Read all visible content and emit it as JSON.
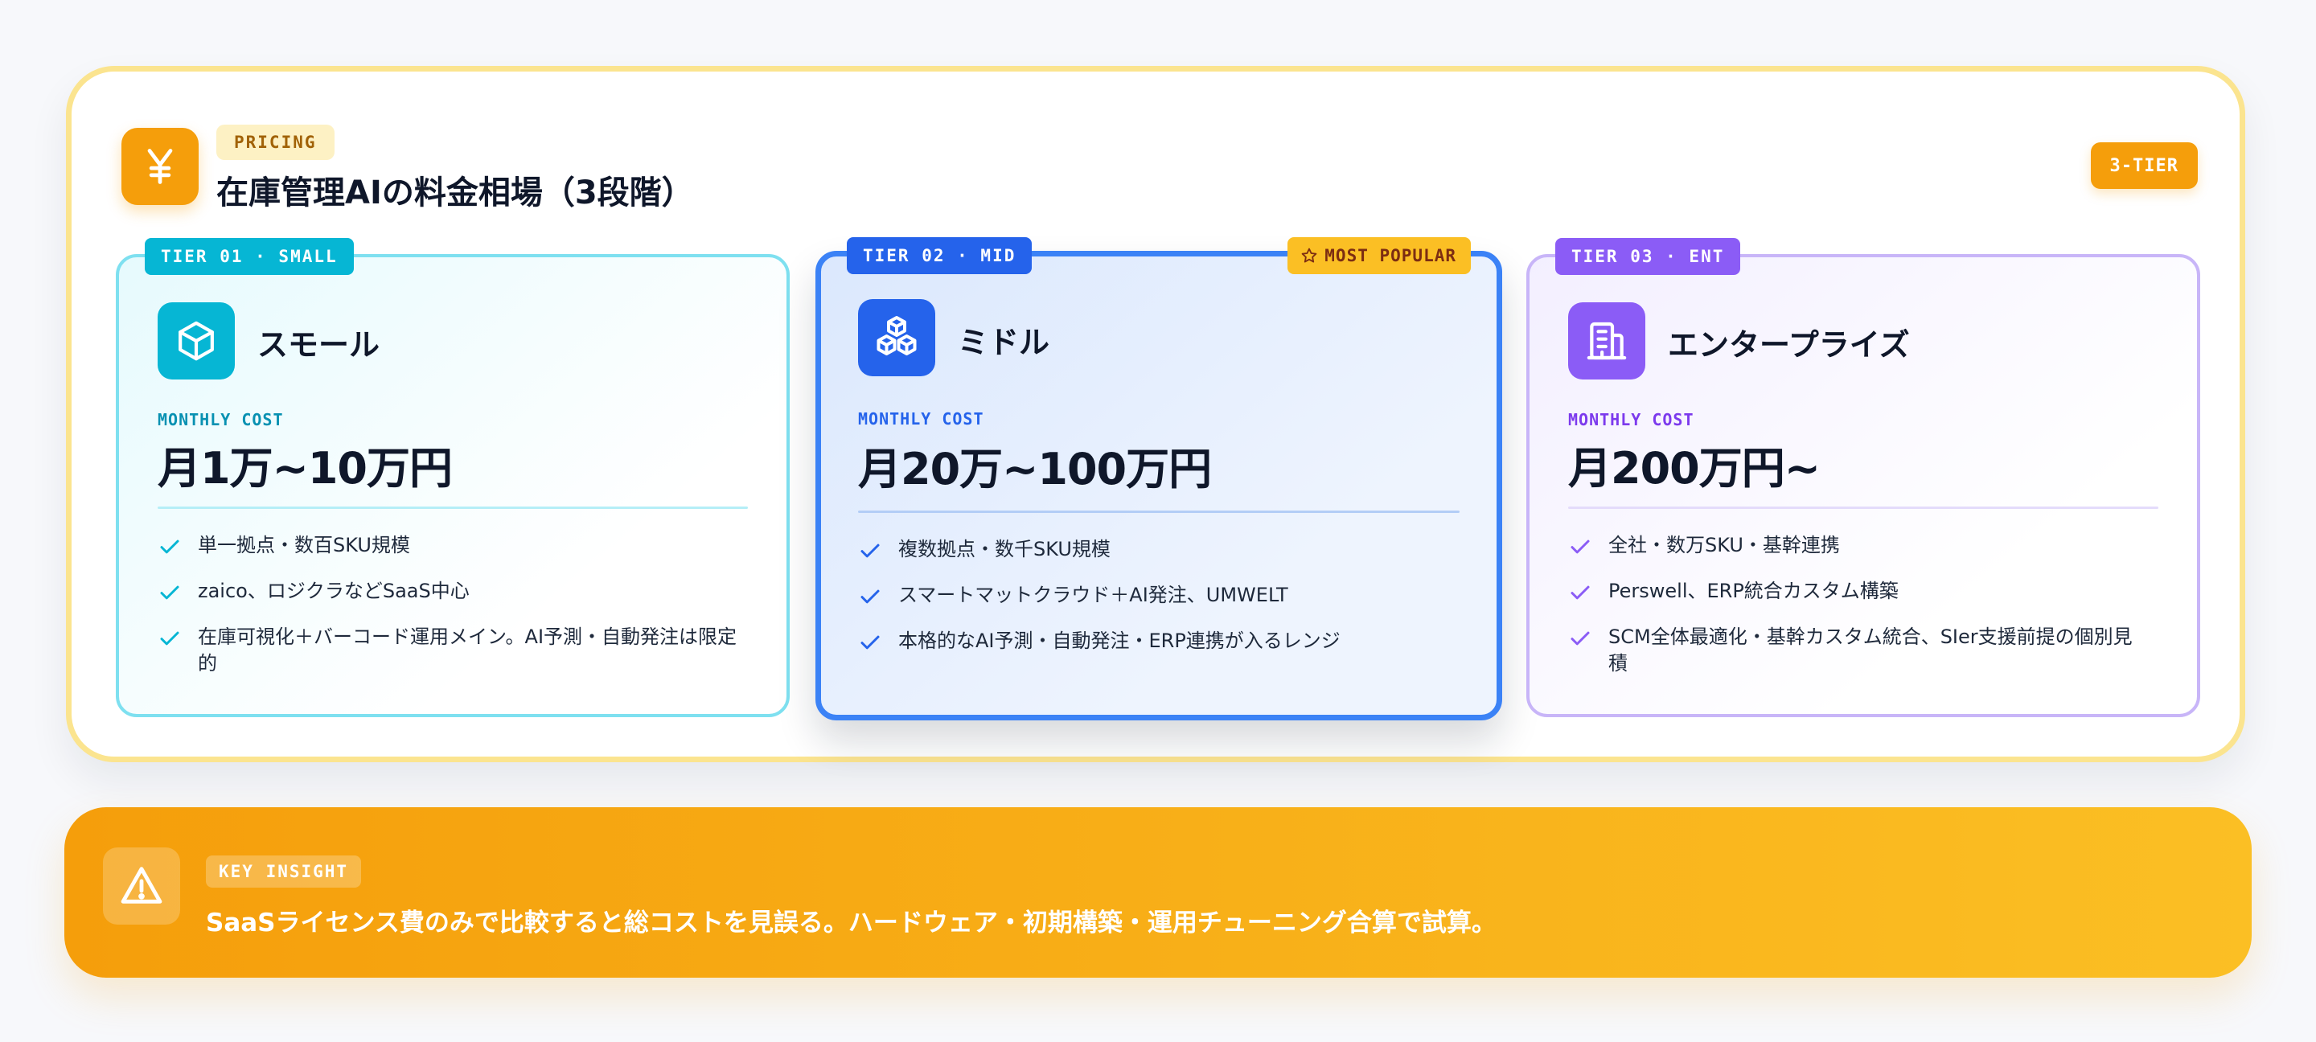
{
  "header": {
    "icon": "yen-icon",
    "tag": "PRICING",
    "title": "在庫管理AIの料金相場（3段階）",
    "tier_count": "3-TIER"
  },
  "tiers": [
    {
      "tag": "TIER 01 · SMALL",
      "icon": "box-icon",
      "name": "スモール",
      "cost_label": "MONTHLY COST",
      "price": "月1万~10万円",
      "features": [
        "単一拠点・数百SKU規模",
        "zaico、ロジクラなどSaaS中心",
        "在庫可視化＋バーコード運用メイン。AI予測・自動発注は限定的"
      ],
      "accent": "#06b6d4"
    },
    {
      "tag": "TIER 02 · MID",
      "badge": "MOST POPULAR",
      "icon": "boxes-icon",
      "name": "ミドル",
      "cost_label": "MONTHLY COST",
      "price": "月20万~100万円",
      "features": [
        "複数拠点・数千SKU規模",
        "スマートマットクラウド＋AI発注、UMWELT",
        "本格的なAI予測・自動発注・ERP連携が入るレンジ"
      ],
      "accent": "#2563eb"
    },
    {
      "tag": "TIER 03 · ENT",
      "icon": "building-icon",
      "name": "エンタープライズ",
      "cost_label": "MONTHLY COST",
      "price": "月200万円~",
      "features": [
        "全社・数万SKU・基幹連携",
        "Perswell、ERP統合カスタム構築",
        "SCM全体最適化・基幹カスタム統合、SIer支援前提の個別見積"
      ],
      "accent": "#8b5cf6"
    }
  ],
  "insight": {
    "icon": "warning-icon",
    "tag": "KEY INSIGHT",
    "text": "SaaSライセンス費のみで比較すると総コストを見誤る。ハードウェア・初期構築・運用チューニング合算で試算。"
  },
  "colors": {
    "brand_amber": "#f59e0b",
    "small_accent": "#06b6d4",
    "mid_accent": "#2563eb",
    "ent_accent": "#8b5cf6"
  }
}
